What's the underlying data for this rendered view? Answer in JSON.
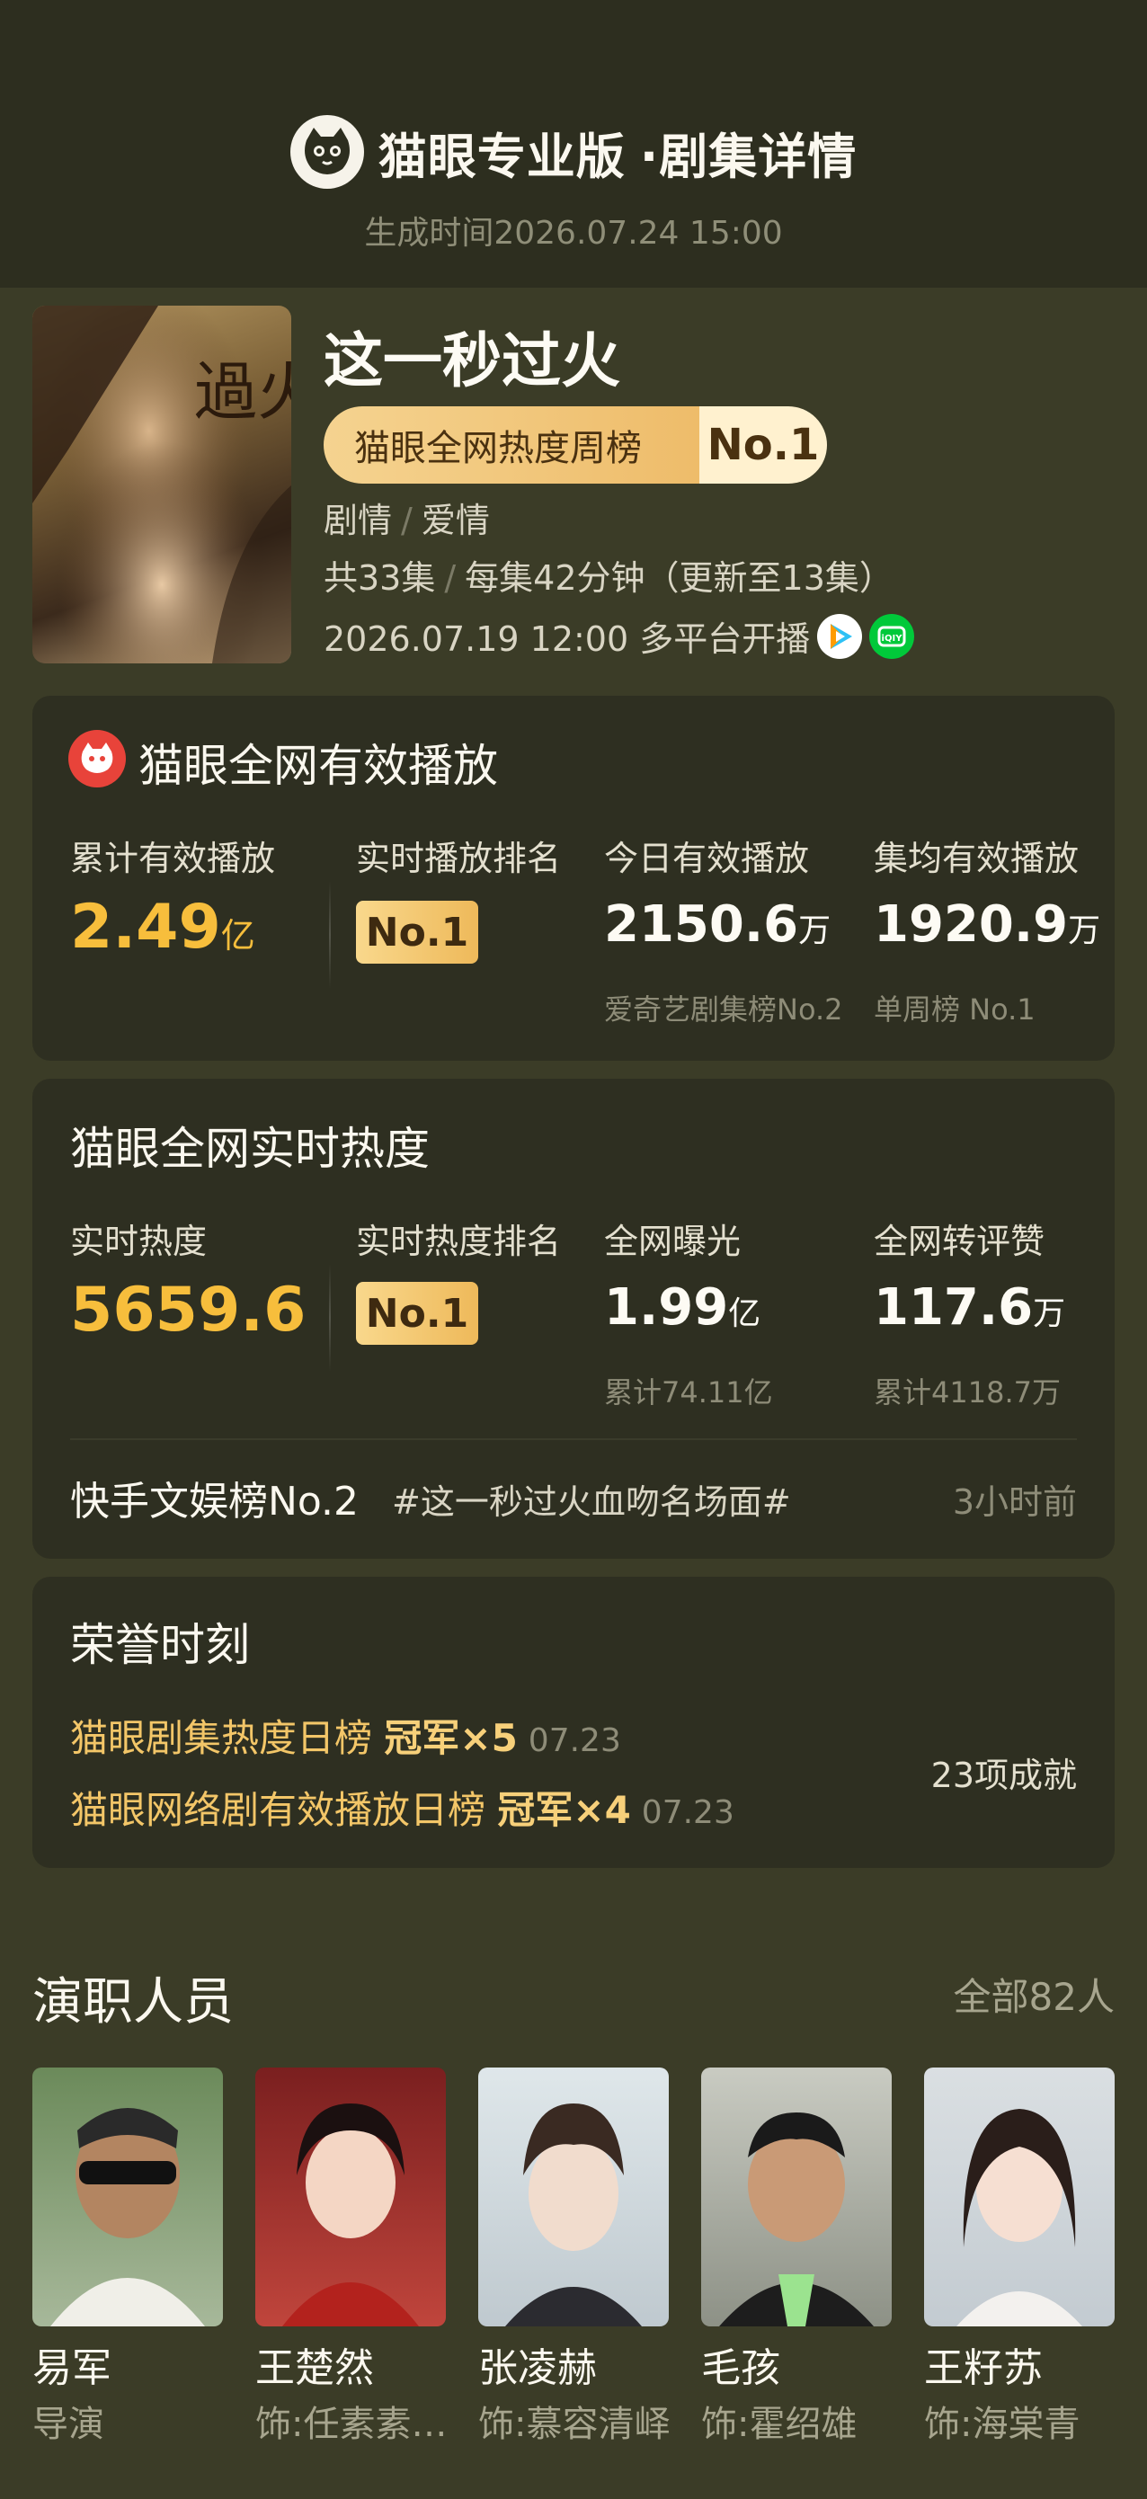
{
  "header": {
    "app_title": "猫眼专业版",
    "page_title": "·剧集详情",
    "generated_time": "生成时间2026.07.24 15:00"
  },
  "show": {
    "title": "这一秒过火",
    "rank_label": "猫眼全网热度周榜",
    "rank_value": "No.1",
    "genres": [
      "剧情",
      "爱情"
    ],
    "episodes_total": "共33集",
    "episode_length": "每集42分钟（更新至13集）",
    "premiere": "2026.07.19 12:00 多平台开播",
    "platforms": [
      "tencent-video-icon",
      "iqiyi-icon"
    ],
    "poster_text": "過火"
  },
  "playback": {
    "title": "猫眼全网有效播放",
    "cumulative_label": "累计有效播放",
    "cumulative_value": "2.49",
    "cumulative_unit": "亿",
    "rank_label": "实时播放排名",
    "rank_value": "No.1",
    "today_label": "今日有效播放",
    "today_value": "2150.6",
    "today_unit": "万",
    "today_sub": "爱奇艺剧集榜No.2",
    "avg_label": "集均有效播放",
    "avg_value": "1920.9",
    "avg_unit": "万",
    "avg_sub": "单周榜 No.1"
  },
  "heat": {
    "title": "猫眼全网实时热度",
    "realtime_label": "实时热度",
    "realtime_value": "5659.6",
    "rank_label": "实时热度排名",
    "rank_value": "No.1",
    "exposure_label": "全网曝光",
    "exposure_value": "1.99",
    "exposure_unit": "亿",
    "exposure_sub": "累计74.11亿",
    "engagement_label": "全网转评赞",
    "engagement_value": "117.6",
    "engagement_unit": "万",
    "engagement_sub": "累计4118.7万",
    "news_rank": "快手文娱榜No.2",
    "news_topic": "#这一秒过火血吻名场面#",
    "news_time": "3小时前"
  },
  "honors": {
    "title": "荣誉时刻",
    "items": [
      {
        "name": "猫眼剧集热度日榜",
        "award": "冠军×5",
        "date": "07.23"
      },
      {
        "name": "猫眼网络剧有效播放日榜",
        "award": "冠军×4",
        "date": "07.23"
      }
    ],
    "achievements": "23项成就"
  },
  "cast": {
    "title": "演职人员",
    "all_label": "全部82人",
    "members": [
      {
        "name": "易军",
        "role": "导演"
      },
      {
        "name": "王楚然",
        "role": "饰:任素素/..."
      },
      {
        "name": "张凌赫",
        "role": "饰:慕容清峄"
      },
      {
        "name": "毛孩",
        "role": "饰:霍绍雄"
      },
      {
        "name": "王籽苏",
        "role": "饰:海棠青"
      }
    ]
  },
  "colors": {
    "background": "#3b3c27",
    "header_bg": "#2d2e1f",
    "card_bg": "#2e2f21",
    "accent_gold": "#f7be3c",
    "badge_gold": "#eebc6a"
  }
}
